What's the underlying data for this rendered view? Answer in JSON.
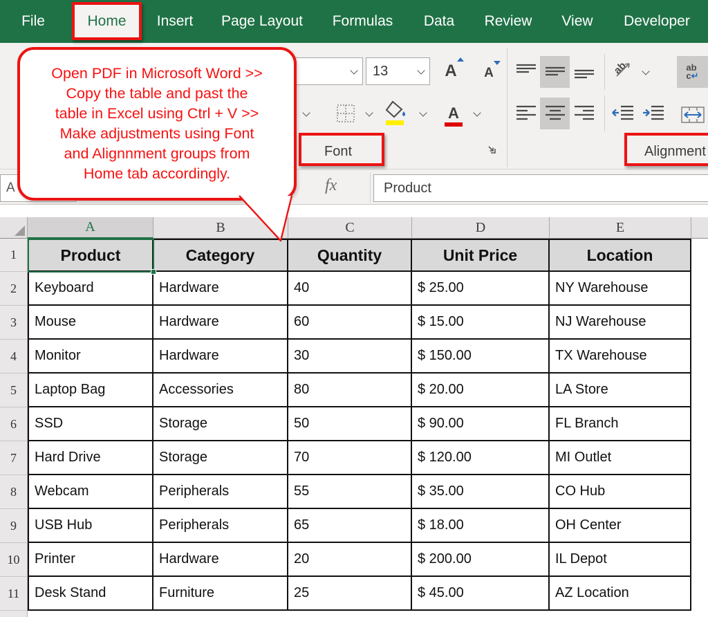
{
  "colors": {
    "excel_green": "#1F7246",
    "annotation_red": "#EC1313",
    "table_header_fill": "#D9D9D9",
    "fill_color_yellow": "#FFF000",
    "font_color_red": "#DF0000",
    "accent_blue": "#2B6CB8"
  },
  "tabs": {
    "items": [
      "File",
      "Home",
      "Insert",
      "Page Layout",
      "Formulas",
      "Data",
      "Review",
      "View",
      "Developer"
    ],
    "active": "Home"
  },
  "ribbon": {
    "font_size_value": "13",
    "font_group_label": "Font",
    "alignment_group_label": "Alignment",
    "icons": {
      "grow_font_letter": "A",
      "shrink_font_letter": "A",
      "font_color_letter": "A",
      "wrap_line1": "ab",
      "wrap_line2_c": "c",
      "wrap_return": "↵",
      "orientation_text": "ab"
    }
  },
  "callout": {
    "lines": [
      "Open PDF in Microsoft Word >>",
      "Copy the table and past the",
      "table in Excel using Ctrl + V >>",
      "Make adjustments using Font",
      "and Alignnment groups from",
      "Home tab accordingly."
    ]
  },
  "formula_bar": {
    "name_box_value": "A",
    "fx_label": "fx",
    "formula_value": "Product"
  },
  "sheet": {
    "column_letters": [
      "A",
      "B",
      "C",
      "D",
      "E"
    ],
    "selected_cell_column": "A",
    "first_row_number": "1",
    "header_row": [
      "Product",
      "Category",
      "Quantity",
      "Unit Price",
      "Location"
    ],
    "rows": [
      {
        "n": "2",
        "cells": [
          "Keyboard",
          "Hardware",
          "40",
          "$ 25.00",
          "NY Warehouse"
        ]
      },
      {
        "n": "3",
        "cells": [
          "Mouse",
          "Hardware",
          "60",
          "$ 15.00",
          "NJ Warehouse"
        ]
      },
      {
        "n": "4",
        "cells": [
          "Monitor",
          "Hardware",
          "30",
          "$ 150.00",
          "TX Warehouse"
        ]
      },
      {
        "n": "5",
        "cells": [
          "Laptop Bag",
          "Accessories",
          "80",
          "$ 20.00",
          "LA Store"
        ]
      },
      {
        "n": "6",
        "cells": [
          "SSD",
          "Storage",
          "50",
          "$ 90.00",
          "FL Branch"
        ]
      },
      {
        "n": "7",
        "cells": [
          "Hard Drive",
          "Storage",
          "70",
          "$ 120.00",
          "MI Outlet"
        ]
      },
      {
        "n": "8",
        "cells": [
          "Webcam",
          "Peripherals",
          "55",
          "$ 35.00",
          "CO Hub"
        ]
      },
      {
        "n": "9",
        "cells": [
          "USB Hub",
          "Peripherals",
          "65",
          "$ 18.00",
          "OH Center"
        ]
      },
      {
        "n": "10",
        "cells": [
          "Printer",
          "Hardware",
          "20",
          "$ 200.00",
          "IL Depot"
        ]
      },
      {
        "n": "11",
        "cells": [
          "Desk Stand",
          "Furniture",
          "25",
          "$ 45.00",
          "AZ Location"
        ]
      }
    ]
  }
}
